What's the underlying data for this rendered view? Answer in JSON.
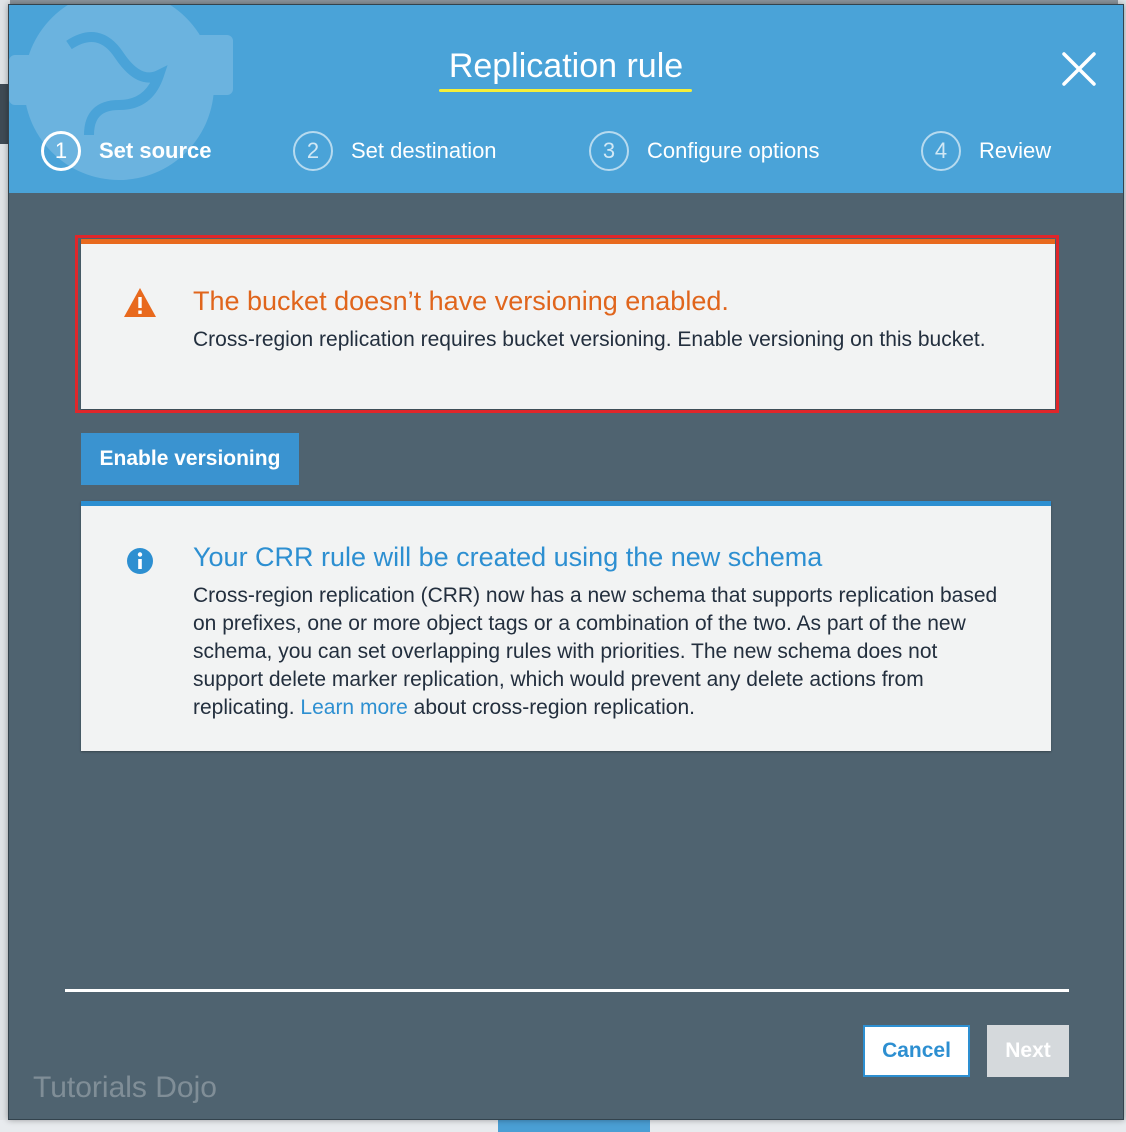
{
  "modal": {
    "title": "Replication rule",
    "close_icon": "close-icon"
  },
  "steps": [
    {
      "number": "1",
      "label": "Set source",
      "active": true
    },
    {
      "number": "2",
      "label": "Set destination",
      "active": false
    },
    {
      "number": "3",
      "label": "Configure options",
      "active": false
    },
    {
      "number": "4",
      "label": "Review",
      "active": false
    }
  ],
  "warning": {
    "icon": "warning-triangle-icon",
    "title": "The bucket doesn’t have versioning enabled.",
    "body": "Cross-region replication requires bucket versioning. Enable versioning on this bucket."
  },
  "enable_versioning_label": "Enable versioning",
  "info": {
    "icon": "info-circle-icon",
    "title": "Your CRR rule will be created using the new schema",
    "body_before_link": "Cross-region replication (CRR) now has a new schema that supports replication based on prefixes, one or more object tags or a combination of the two. As part of the new schema, you can set overlapping rules with priorities. The new schema does not support delete marker replication, which would prevent any delete actions from replicating.",
    "link_text": "Learn more",
    "body_after_link": "about cross-region replication."
  },
  "footer": {
    "cancel_label": "Cancel",
    "next_label": "Next"
  },
  "watermark": "Tutorials Dojo",
  "colors": {
    "header_blue": "#4aa3d8",
    "modal_body": "#4f6370",
    "warning_orange": "#e0651c",
    "info_blue": "#2d8fd1",
    "highlight_red": "#e0262a",
    "title_underline": "#f5ef3a"
  }
}
